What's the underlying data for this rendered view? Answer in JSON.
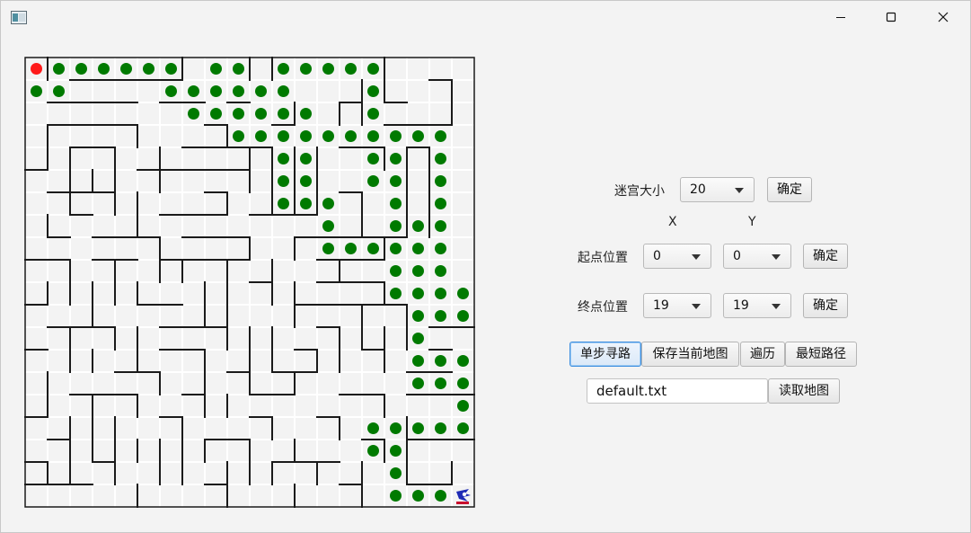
{
  "titlebar": {
    "title": ""
  },
  "maze": {
    "size_label": "迷宫大小",
    "size_value": "20",
    "confirm_label": "确定"
  },
  "coords": {
    "x_label": "X",
    "y_label": "Y"
  },
  "start": {
    "label": "起点位置",
    "x": "0",
    "y": "0",
    "confirm_label": "确定"
  },
  "end": {
    "label": "终点位置",
    "x": "19",
    "y": "19",
    "confirm_label": "确定"
  },
  "actions": {
    "step_label": "单步寻路",
    "save_label": "保存当前地图",
    "traverse_label": "遍历",
    "shortest_label": "最短路径"
  },
  "file": {
    "value": "default.txt",
    "load_label": "读取地图"
  },
  "colors": {
    "path": "#007a00",
    "start": "#ff1a1a",
    "wall": "#1a1a1a",
    "grid": "#ffffff"
  }
}
